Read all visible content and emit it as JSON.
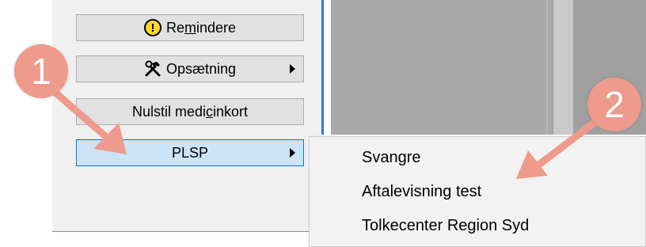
{
  "left_menu": {
    "buttons": [
      {
        "label_pre": "Re",
        "label_underline": "m",
        "label_post": "indere",
        "icon": "warning-icon"
      },
      {
        "label": "Opsætning",
        "icon": "hammer-wrench-icon",
        "has_submenu": true
      },
      {
        "label_pre": "Nulstil medi",
        "label_underline": "c",
        "label_post": "inkort"
      },
      {
        "label": "PLSP",
        "has_submenu": true,
        "active": true
      }
    ]
  },
  "submenu": {
    "items": [
      "Svangre",
      "Aftalevisning test",
      "Tolkecenter Region Syd"
    ]
  },
  "annotations": {
    "badge1": "1",
    "badge2": "2",
    "color": "#ee9a8c"
  },
  "colors": {
    "highlight_fill": "#cce4f7",
    "highlight_border": "#0078d7",
    "panel_bg": "#f0f0f0"
  }
}
